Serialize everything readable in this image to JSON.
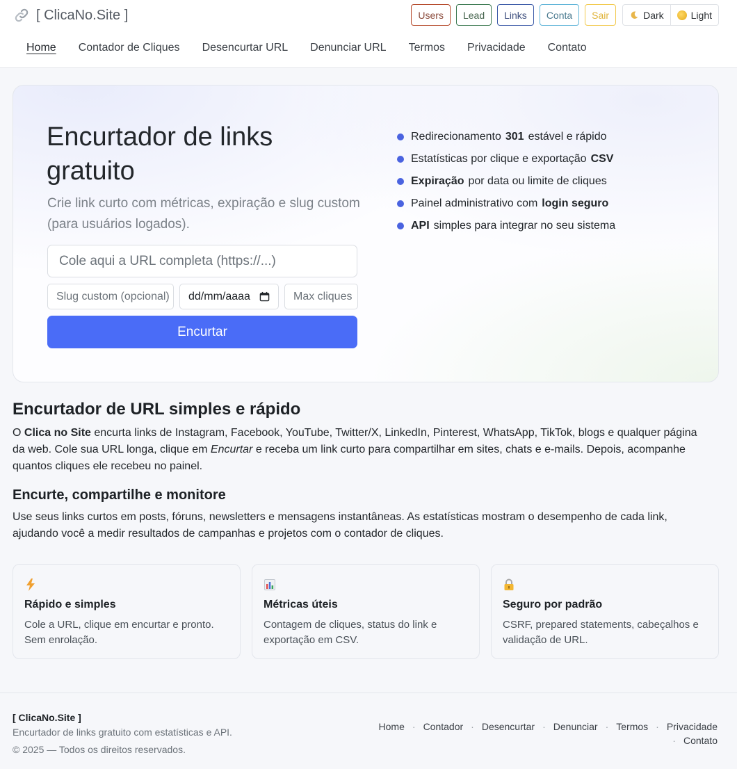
{
  "header": {
    "brand": "[ ClicaNo.Site ]",
    "actions": {
      "users": "Users",
      "lead": "Lead",
      "links": "Links",
      "conta": "Conta",
      "sair": "Sair"
    },
    "theme": {
      "dark": "Dark",
      "light": "Light"
    },
    "nav": [
      "Home",
      "Contador de Cliques",
      "Desencurtar URL",
      "Denunciar URL",
      "Termos",
      "Privacidade",
      "Contato"
    ]
  },
  "hero": {
    "title": "Encurtador de links gratuito",
    "subtitle": "Crie link curto com métricas, expiração e slug custom (para usuários logados).",
    "url_placeholder": "Cole aqui a URL completa (https://...)",
    "slug_placeholder": "Slug custom (opcional)",
    "date_placeholder": "dd/mm/aaaa",
    "max_placeholder": "Max cliques",
    "submit_label": "Encurtar",
    "features": [
      {
        "pre": "Redirecionamento",
        "bold": "301",
        "post": "estável e rápido"
      },
      {
        "pre": "Estatísticas por clique e exportação",
        "bold": "CSV",
        "post": ""
      },
      {
        "pre": "",
        "bold": "Expiração",
        "post": "por data ou limite de cliques"
      },
      {
        "pre": "Painel administrativo com",
        "bold": "login seguro",
        "post": ""
      },
      {
        "pre": "",
        "bold": "API",
        "post": "simples para integrar no seu sistema"
      }
    ]
  },
  "section1": {
    "title": "Encurtador de URL simples e rápido",
    "p_start": "O ",
    "p_bold": "Clica no Site",
    "p_mid": " encurta links de Instagram, Facebook, YouTube, Twitter/X, LinkedIn, Pinterest, WhatsApp, TikTok, blogs e qualquer página da web. Cole sua URL longa, clique em ",
    "p_em": "Encurtar",
    "p_end": " e receba um link curto para compartilhar em sites, chats e e-mails. Depois, acompanhe quantos cliques ele recebeu no painel."
  },
  "section2": {
    "title": "Encurte, compartilhe e monitore",
    "text": "Use seus links curtos em posts, fóruns, newsletters e mensagens instantâneas. As estatísticas mostram o desempenho de cada link, ajudando você a medir resultados de campanhas e projetos com o contador de cliques."
  },
  "cards": [
    {
      "icon": "lightning-icon",
      "title": "Rápido e simples",
      "text": "Cole a URL, clique em encurtar e pronto. Sem enrolação."
    },
    {
      "icon": "bar-chart-icon",
      "title": "Métricas úteis",
      "text": "Contagem de cliques, status do link e exportação em CSV."
    },
    {
      "icon": "lock-icon",
      "title": "Seguro por padrão",
      "text": "CSRF, prepared statements, cabeçalhos e validação de URL."
    }
  ],
  "footer": {
    "brand": "[ ClicaNo.Site ]",
    "description": "Encurtador de links gratuito com estatísticas e API.",
    "copyright": "© 2025 — Todos os direitos reservados.",
    "links": [
      "Home",
      "Contador",
      "Desencurtar",
      "Denunciar",
      "Termos",
      "Privacidade",
      "Contato"
    ],
    "separator": "·"
  },
  "colors": {
    "primary": "#4a6cf7",
    "bullet": "#4a63e0"
  }
}
